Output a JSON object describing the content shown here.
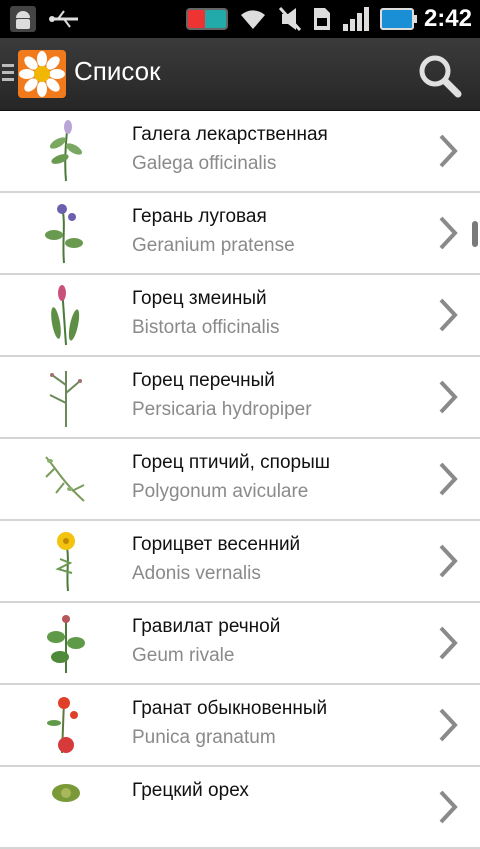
{
  "status_bar": {
    "time": "2:42",
    "icons": [
      "android-debug-icon",
      "usb-icon",
      "battery-app-icon",
      "wifi-icon",
      "mute-icon",
      "sim-icon",
      "signal-icon",
      "battery-charging-icon"
    ]
  },
  "action_bar": {
    "title": "Список",
    "icons": [
      "menu-icon",
      "app-daisy-icon",
      "search-icon"
    ]
  },
  "list": {
    "items": [
      {
        "title": "Галега лекарственная",
        "subtitle": "Galega officinalis"
      },
      {
        "title": "Герань луговая",
        "subtitle": "Geranium pratense"
      },
      {
        "title": "Горец змеиный",
        "subtitle": "Bistorta officinalis"
      },
      {
        "title": "Горец перечный",
        "subtitle": "Persicaria hydropiper"
      },
      {
        "title": "Горец птичий, спорыш",
        "subtitle": "Polygonum aviculare"
      },
      {
        "title": "Горицвет весенний",
        "subtitle": "Adonis vernalis"
      },
      {
        "title": "Гравилат речной",
        "subtitle": "Geum rivale"
      },
      {
        "title": "Гранат обыкновенный",
        "subtitle": "Punica granatum"
      },
      {
        "title": "Грецкий орех",
        "subtitle": ""
      }
    ]
  },
  "colors": {
    "action_bar": "#2d2d2d",
    "app_icon": "#f07a1c",
    "divider": "#d4d4d4",
    "subtitle": "#8a8a8a"
  }
}
